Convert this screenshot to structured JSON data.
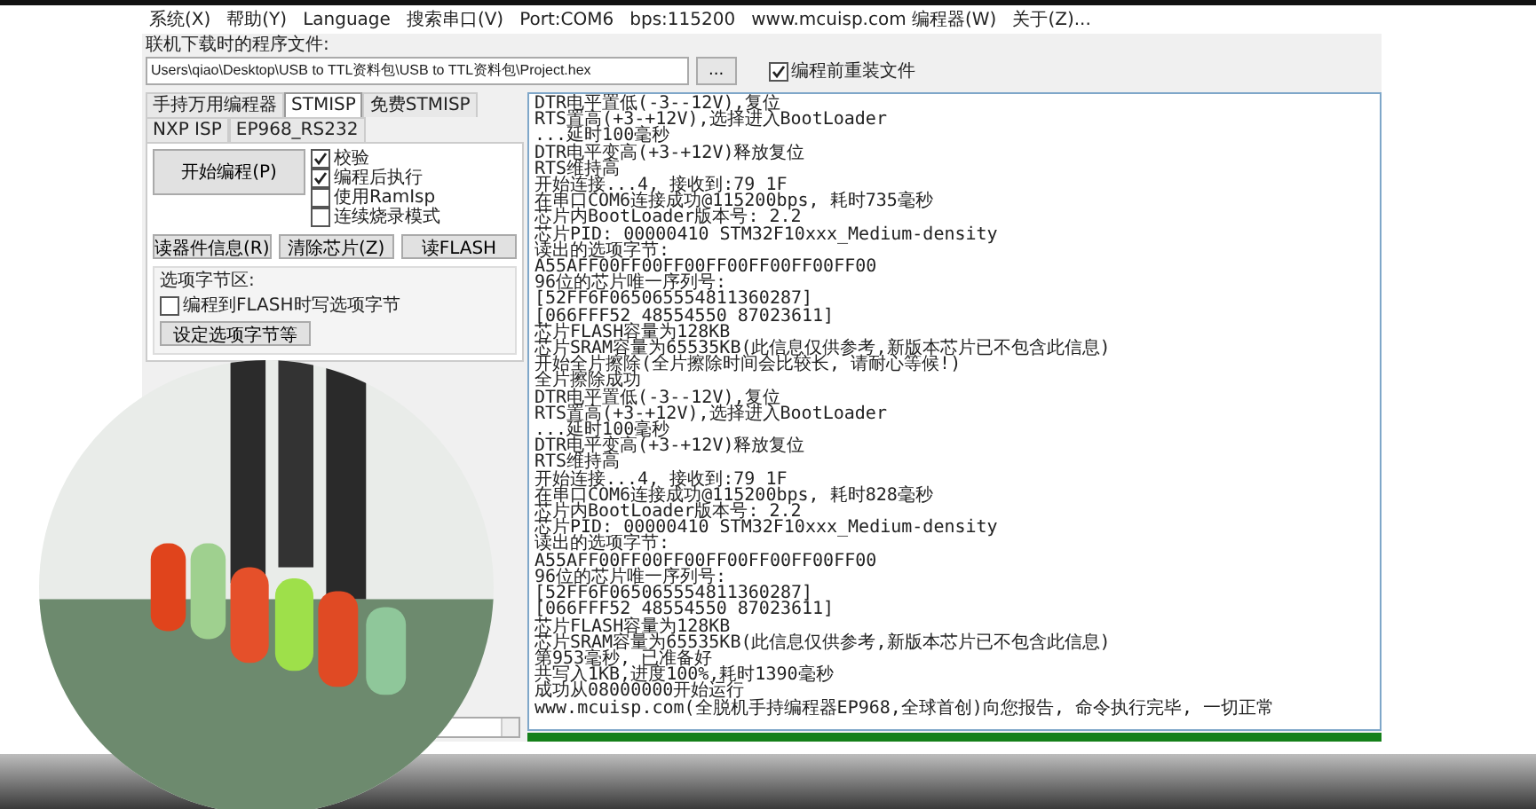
{
  "menu": [
    "系统(X)",
    "帮助(Y)",
    "Language",
    "搜索串口(V)",
    "Port:COM6",
    "bps:115200",
    "www.mcuisp.com 编程器(W)",
    "关于(Z)..."
  ],
  "file_label": "联机下载时的程序文件:",
  "file_path": "Users\\qiao\\Desktop\\USB to TTL资料包\\USB to TTL资料包\\Project.hex",
  "browse_button": "...",
  "reload_option": {
    "label": "编程前重装文件",
    "checked": true
  },
  "tabs": [
    {
      "label": "手持万用编程器",
      "selected": false
    },
    {
      "label": "STMISP",
      "selected": true
    },
    {
      "label": "免费STMISP",
      "selected": false
    },
    {
      "label": "NXP ISP",
      "selected": false
    },
    {
      "label": "EP968_RS232",
      "selected": false
    }
  ],
  "start_button": "开始编程(P)",
  "options": [
    {
      "label": "校验",
      "checked": true
    },
    {
      "label": "编程后执行",
      "checked": true
    },
    {
      "label": "使用RamIsp",
      "checked": false
    },
    {
      "label": "连续烧录模式",
      "checked": false
    }
  ],
  "action_buttons": [
    "读器件信息(R)",
    "清除芯片(Z)",
    "读FLASH"
  ],
  "option_bytes": {
    "title": "选项字节区:",
    "write_option": {
      "label": "编程到FLASH时写选项字节",
      "checked": false
    },
    "button": "设定选项字节等"
  },
  "log_lines": [
    "DTR电平置低(-3--12V),复位",
    "RTS置高(+3-+12V),选择进入BootLoader",
    "...延时100毫秒",
    "DTR电平变高(+3-+12V)释放复位",
    "RTS维持高",
    "开始连接...4, 接收到:79 1F",
    "在串口COM6连接成功@115200bps, 耗时735毫秒",
    "芯片内BootLoader版本号: 2.2",
    "芯片PID: 00000410  STM32F10xxx_Medium-density",
    "读出的选项字节:",
    "A55AFF00FF00FF00FF00FF00FF00FF00",
    "96位的芯片唯一序列号:",
    "[52FF6F065065554811360287]",
    "[066FFF52 48554550 87023611]",
    "芯片FLASH容量为128KB",
    "芯片SRAM容量为65535KB(此信息仅供参考,新版本芯片已不包含此信息)",
    "开始全片擦除(全片擦除时间会比较长, 请耐心等候!)",
    "全片擦除成功",
    "DTR电平置低(-3--12V),复位",
    "RTS置高(+3-+12V),选择进入BootLoader",
    "...延时100毫秒",
    "DTR电平变高(+3-+12V)释放复位",
    "RTS维持高",
    "开始连接...4, 接收到:79 1F",
    "在串口COM6连接成功@115200bps, 耗时828毫秒",
    "芯片内BootLoader版本号: 2.2",
    "芯片PID: 00000410  STM32F10xxx_Medium-density",
    "读出的选项字节:",
    "A55AFF00FF00FF00FF00FF00FF00FF00",
    "96位的芯片唯一序列号:",
    "[52FF6F065065554811360287]",
    "[066FFF52 48554550 87023611]",
    "芯片FLASH容量为128KB",
    "芯片SRAM容量为65535KB(此信息仅供参考,新版本芯片已不包含此信息)",
    "第953毫秒, 已准备好",
    "共写入1KB,进度100%,耗时1390毫秒",
    "成功从08000000开始运行",
    "www.mcuisp.com(全脱机手持编程器EP968,全球首创)向您报告, 命令执行完毕, 一切正常"
  ],
  "progress": {
    "level": 1
  }
}
